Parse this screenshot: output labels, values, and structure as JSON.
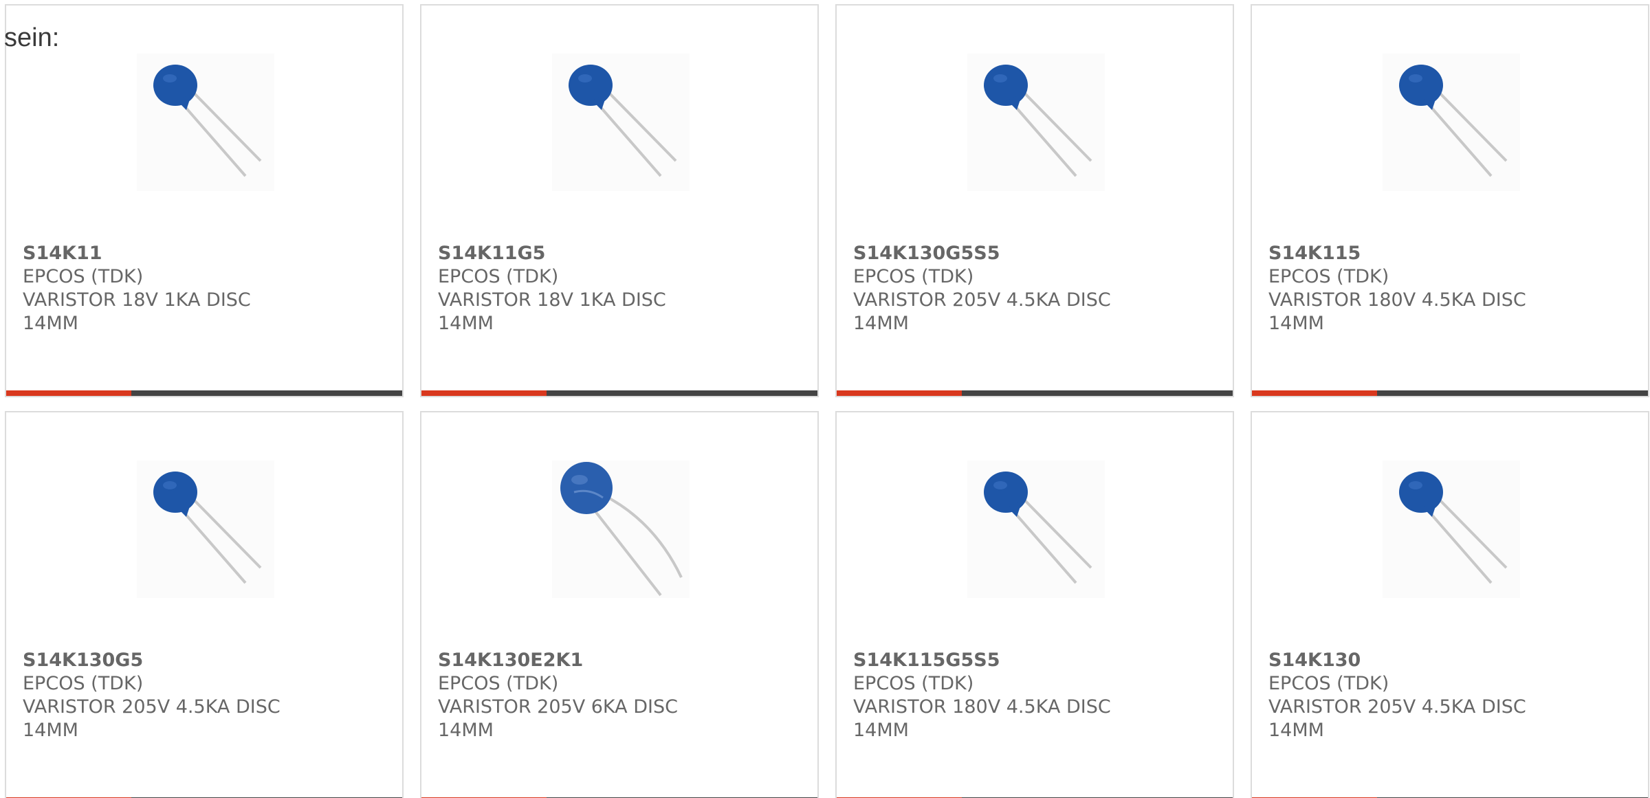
{
  "intro": "sein:",
  "colors": {
    "accent": "#d9381e",
    "bar": "#444444",
    "text": "#666666",
    "varistor_blue": "#1e56a8",
    "border": "#dcdcdc"
  },
  "products": [
    {
      "part": "S14K11",
      "manufacturer": "EPCOS (TDK)",
      "description": "VARISTOR 18V 1KA DISC 14MM",
      "icon": "varistor-icon"
    },
    {
      "part": "S14K11G5",
      "manufacturer": "EPCOS (TDK)",
      "description": "VARISTOR 18V 1KA DISC 14MM",
      "icon": "varistor-icon"
    },
    {
      "part": "S14K130G5S5",
      "manufacturer": "EPCOS (TDK)",
      "description": "VARISTOR 205V 4.5KA DISC 14MM",
      "icon": "varistor-icon"
    },
    {
      "part": "S14K115",
      "manufacturer": "EPCOS (TDK)",
      "description": "VARISTOR 180V 4.5KA DISC 14MM",
      "icon": "varistor-icon"
    },
    {
      "part": "S14K130G5",
      "manufacturer": "EPCOS (TDK)",
      "description": "VARISTOR 205V 4.5KA DISC 14MM",
      "icon": "varistor-icon"
    },
    {
      "part": "S14K130E2K1",
      "manufacturer": "EPCOS (TDK)",
      "description": "VARISTOR 205V 6KA DISC 14MM",
      "icon": "varistor-icon"
    },
    {
      "part": "S14K115G5S5",
      "manufacturer": "EPCOS (TDK)",
      "description": "VARISTOR 180V 4.5KA DISC 14MM",
      "icon": "varistor-icon"
    },
    {
      "part": "S14K130",
      "manufacturer": "EPCOS (TDK)",
      "description": "VARISTOR 205V 4.5KA DISC 14MM",
      "icon": "varistor-icon"
    }
  ]
}
